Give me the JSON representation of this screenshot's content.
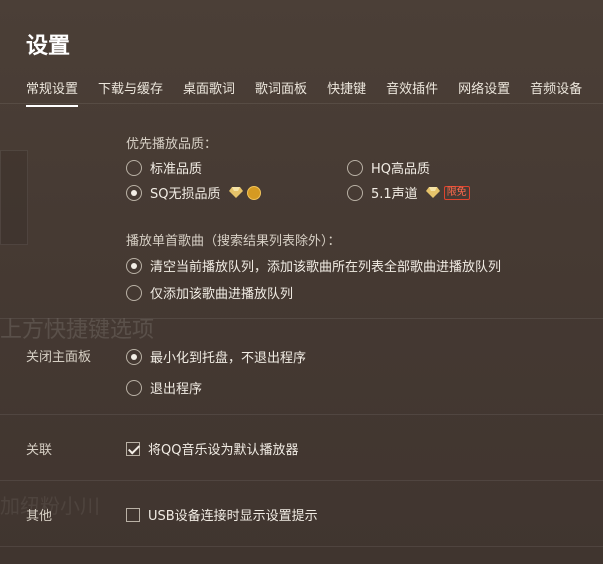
{
  "header": {
    "title": "设置"
  },
  "tabs": [
    {
      "label": "常规设置",
      "active": true
    },
    {
      "label": "下载与缓存"
    },
    {
      "label": "桌面歌词"
    },
    {
      "label": "歌词面板"
    },
    {
      "label": "快捷键"
    },
    {
      "label": "音效插件"
    },
    {
      "label": "网络设置"
    },
    {
      "label": "音频设备"
    }
  ],
  "playback": {
    "quality_label": "优先播放品质：",
    "quality_options": {
      "standard": "标准品质",
      "hq": "HQ高品质",
      "sq": "SQ无损品质",
      "surround": "5.1声道",
      "free_badge": "限免"
    },
    "quality_selected": "sq",
    "single_label": "播放单首歌曲（搜索结果列表除外）：",
    "single_options": {
      "clear_queue": "清空当前播放队列，添加该歌曲所在列表全部歌曲进播放队列",
      "add_only": "仅添加该歌曲进播放队列"
    },
    "single_selected": "clear_queue"
  },
  "close_panel": {
    "label": "关闭主面板",
    "options": {
      "minimize": "最小化到托盘，不退出程序",
      "exit": "退出程序"
    },
    "selected": "minimize"
  },
  "association": {
    "label": "关联",
    "default_player": "将QQ音乐设为默认播放器",
    "checked": true
  },
  "other": {
    "label": "其他",
    "usb_prompt": "USB设备连接时显示设置提示",
    "checked": false
  },
  "colors": {
    "background": "#463a33",
    "accent_badge": "#e0442e",
    "coin": "#d59a22"
  }
}
